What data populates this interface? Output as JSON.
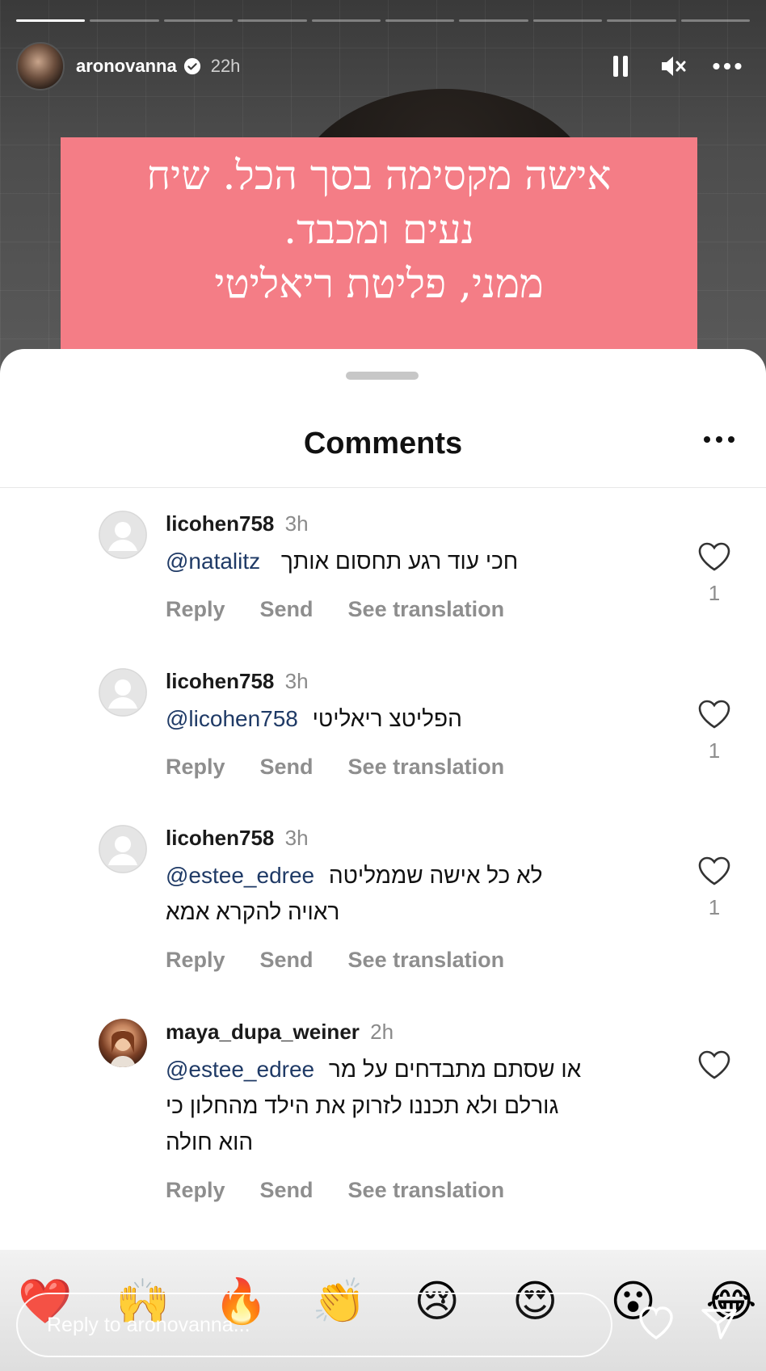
{
  "story": {
    "username": "aronovanna",
    "time": "22h",
    "banner_lines": [
      "אישה מקסימה בסך הכל. שיח",
      "נעים ומכבד.",
      "ממני, פליטת ריאליטי"
    ]
  },
  "sheet": {
    "title": "Comments"
  },
  "comments": [
    {
      "user": "licohen758",
      "time": "3h",
      "mention": "@natalitz",
      "lines": [
        "חכי עוד רגע תחסום אותך"
      ],
      "likes": "1",
      "avatar": "default"
    },
    {
      "user": "licohen758",
      "time": "3h",
      "mention": "@licohen758",
      "lines": [
        "הפליטצ ריאליטי"
      ],
      "likes": "1",
      "avatar": "default"
    },
    {
      "user": "licohen758",
      "time": "3h",
      "mention": "@estee_edree",
      "lines": [
        "לא כל אישה שממליטה",
        "ראויה להקרא אמא"
      ],
      "likes": "1",
      "avatar": "default"
    },
    {
      "user": "maya_dupa_weiner",
      "time": "2h",
      "mention": "@estee_edree",
      "lines": [
        "או שסתם מתבדחים על מר",
        "גורלם ולא תכננו לזרוק את הילד מהחלון כי",
        "הוא חולה"
      ],
      "likes": "",
      "avatar": "photo"
    }
  ],
  "actions": {
    "reply": "Reply",
    "send": "Send",
    "translate": "See translation"
  },
  "reactions": [
    "❤️",
    "🙌",
    "🔥",
    "👏",
    "😢",
    "😍",
    "😮",
    "😂"
  ],
  "reply_placeholder": "Reply to aronovanna...",
  "colors": {
    "banner": "#f47d86",
    "mention": "#1f3a66",
    "muted": "#8e8e8e"
  }
}
